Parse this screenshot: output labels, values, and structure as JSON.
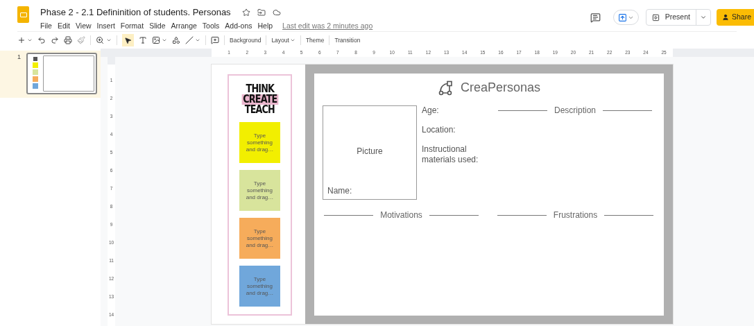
{
  "app": {
    "title": "Phase 2 - 2.1 Defininition of students. Personas",
    "menu": [
      "File",
      "Edit",
      "View",
      "Insert",
      "Format",
      "Slide",
      "Arrange",
      "Tools",
      "Add-ons",
      "Help"
    ],
    "last_edit": "Last edit was 2 minutes ago",
    "present": "Present",
    "share": "Share"
  },
  "toolbar": {
    "buttons": [
      {
        "label": "Background",
        "dropdown": false
      },
      {
        "label": "Layout",
        "dropdown": true
      },
      {
        "label": "Theme",
        "dropdown": false
      },
      {
        "label": "Transition",
        "dropdown": false
      }
    ]
  },
  "filmstrip": [
    {
      "number": "1",
      "selected": true
    }
  ],
  "ruler": {
    "horizontal": [
      "1",
      "2",
      "3",
      "4",
      "5",
      "6",
      "7",
      "8",
      "9",
      "10",
      "11",
      "12",
      "13",
      "14",
      "15",
      "16",
      "17",
      "18",
      "19",
      "20",
      "21",
      "22",
      "23",
      "24",
      "25"
    ],
    "vertical": [
      "1",
      "2",
      "3",
      "4",
      "5",
      "6",
      "7",
      "8",
      "9",
      "10",
      "11",
      "12",
      "13",
      "14"
    ]
  },
  "slide": {
    "logo": [
      {
        "text": "THINK",
        "highlight": false
      },
      {
        "text": "CREATE",
        "highlight": true
      },
      {
        "text": "TEACH",
        "highlight": false
      }
    ],
    "notes": [
      {
        "text": "Type something and drag…",
        "color": "#f2ef00"
      },
      {
        "text": "Type something and drag…",
        "color": "#d8e49c"
      },
      {
        "text": "Type something and drag…",
        "color": "#f6ac5b"
      },
      {
        "text": "Type something and drag…",
        "color": "#70a7db"
      }
    ],
    "title": "CreaPersonas",
    "picture_label": "Picture",
    "name_label": "Name:",
    "fields": [
      "Age:",
      "Location:",
      "Instructional materials used:"
    ],
    "description": "Description",
    "sections": [
      "Motivations",
      "Frustrations"
    ]
  }
}
